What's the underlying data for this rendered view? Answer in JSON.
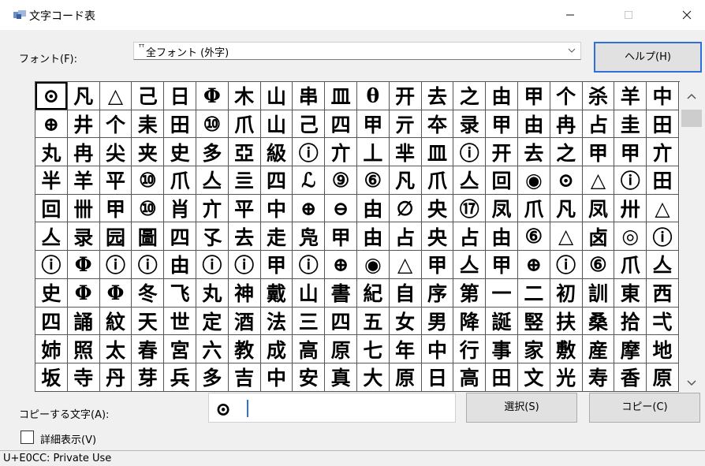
{
  "window": {
    "title": "文字コード表",
    "minimize": "—",
    "close": "✕"
  },
  "font": {
    "label": "フォント(F):",
    "selected": "全フォント (外字)",
    "marker": "ᵀᵀ"
  },
  "buttons": {
    "help": "ヘルプ(H)",
    "select": "選択(S)",
    "copy": "コピー(C)"
  },
  "grid": {
    "selected_index": 0,
    "chars": [
      "⊙",
      "凡",
      "△",
      "己",
      "日",
      "Φ",
      "木",
      "山",
      "串",
      "皿",
      "θ",
      "开",
      "去",
      "之",
      "由",
      "甲",
      "个",
      "杀",
      "羊",
      "中",
      "⊕",
      "井",
      "个",
      "耒",
      "田",
      "⑩",
      "爪",
      "山",
      "己",
      "四",
      "甲",
      "亓",
      "夲",
      "录",
      "甲",
      "由",
      "冉",
      "占",
      "圭",
      "田",
      "丸",
      "冉",
      "尖",
      "夹",
      "史",
      "多",
      "亞",
      "級",
      "ⓘ",
      "亣",
      "丄",
      "芈",
      "皿",
      "ⓘ",
      "开",
      "去",
      "之",
      "甲",
      "甲",
      "亣",
      "半",
      "羊",
      "平",
      "⑩",
      "爪",
      "亼",
      "亖",
      "四",
      "ℒ",
      "⑨",
      "⑥",
      "凡",
      "爪",
      "亼",
      "回",
      "◉",
      "⊙",
      "△",
      "ⓘ",
      "田",
      "回",
      "卌",
      "甲",
      "⑩",
      "肖",
      "亣",
      "平",
      "中",
      "⊕",
      "⊖",
      "由",
      "∅",
      "央",
      "⑰",
      "凤",
      "爪",
      "凡",
      "凤",
      "卅",
      "△",
      "亼",
      "录",
      "园",
      "圖",
      "四",
      "孓",
      "去",
      "走",
      "凫",
      "甲",
      "由",
      "占",
      "央",
      "占",
      "由",
      "⑥",
      "△",
      "卤",
      "◎",
      "ⓘ",
      "ⓘ",
      "Φ",
      "ⓘ",
      "ⓘ",
      "由",
      "ⓘ",
      "ⓘ",
      "甲",
      "ⓘ",
      "⊕",
      "◉",
      "△",
      "甲",
      "亼",
      "甲",
      "⊕",
      "ⓘ",
      "⑥",
      "爪",
      "亼",
      "史",
      "Φ",
      "Φ",
      "冬",
      "飞",
      "丸",
      "神",
      "戴",
      "山",
      "書",
      "紀",
      "自",
      "序",
      "第",
      "一",
      "二",
      "初",
      "訓",
      "東",
      "西",
      "四",
      "誦",
      "紋",
      "天",
      "世",
      "定",
      "酒",
      "法",
      "三",
      "四",
      "五",
      "女",
      "男",
      "降",
      "誕",
      "竪",
      "扶",
      "桑",
      "拾",
      "弌",
      "姉",
      "照",
      "太",
      "春",
      "宮",
      "六",
      "教",
      "成",
      "高",
      "原",
      "七",
      "年",
      "中",
      "行",
      "事",
      "家",
      "敷",
      "産",
      "摩",
      "地",
      "坂",
      "寺",
      "丹",
      "芽",
      "兵",
      "多",
      "吉",
      "中",
      "安",
      "真",
      "大",
      "原",
      "日",
      "高",
      "田",
      "文",
      "光",
      "寿",
      "香",
      "原"
    ]
  },
  "copy": {
    "label": "コピーする文字(A):",
    "value": "⊙"
  },
  "detail": {
    "label": "詳細表示(V)"
  },
  "status": {
    "text": "U+E0CC: Private Use"
  }
}
